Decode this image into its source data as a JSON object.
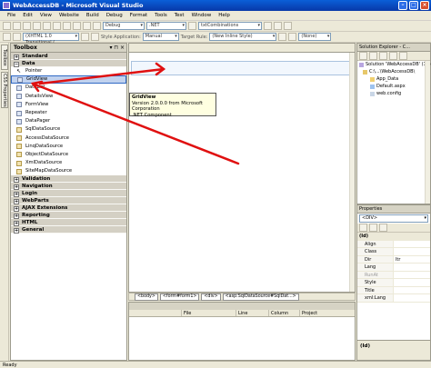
{
  "window": {
    "title": "WebAccessDB - Microsoft Visual Studio"
  },
  "menu": [
    "File",
    "Edit",
    "View",
    "Website",
    "Build",
    "Debug",
    "Format",
    "Tools",
    "Test",
    "Window",
    "Help"
  ],
  "toolbar1": {
    "config": "Debug",
    "platform": ".NET",
    "find": "txtCombinations"
  },
  "toolbar2": {
    "doctype": "(XHTML 1.0 Transitional (",
    "style_application_label": "Style Application:",
    "style_application": "Manual",
    "target_rule_label": "Target Rule:",
    "target_rule": "(New Inline Style)",
    "font": "(None)"
  },
  "left_tabs": [
    "Toolbox",
    "CSS Properties"
  ],
  "toolbox": {
    "title": "Toolbox",
    "categories_top": [
      "Standard",
      "Data"
    ],
    "data_items": [
      "Pointer",
      "GridView",
      "DataList",
      "DetailsView",
      "FormView",
      "Repeater",
      "DataPager",
      "SqlDataSource",
      "AccessDataSource",
      "LinqDataSource",
      "ObjectDataSource",
      "XmlDataSource",
      "SiteMapDataSource"
    ],
    "categories_bottom": [
      "Validation",
      "Navigation",
      "Login",
      "WebParts",
      "AJAX Extensions",
      "Reporting",
      "HTML",
      "General"
    ]
  },
  "tooltip": {
    "title": "GridView",
    "line1": "Version 2.0.0.0 from Microsoft Corporation",
    "line2": ".NET Component"
  },
  "tag_nav": [
    "<body>",
    "<form#form1>",
    "<div>",
    "<asp:SqlDataSource#SqlDat...>"
  ],
  "error_list": {
    "columns": [
      "File",
      "Line",
      "Column",
      "Project"
    ]
  },
  "solution_explorer": {
    "title": "Solution Explorer - C...",
    "nodes": [
      "Solution 'WebAccessDB' (1 project)",
      "C:\\...\\WebAccessDB\\",
      "App_Data",
      "Default.aspx",
      "web.config"
    ]
  },
  "properties": {
    "title": "Properties",
    "selected": "<DIV>",
    "group": "(Id)",
    "rows": [
      {
        "name": "Align",
        "value": ""
      },
      {
        "name": "Class",
        "value": ""
      },
      {
        "name": "Dir",
        "value": "ltr"
      },
      {
        "name": "Lang",
        "value": ""
      },
      {
        "name": "RunAt",
        "value": ""
      },
      {
        "name": "Style",
        "value": ""
      },
      {
        "name": "Title",
        "value": ""
      },
      {
        "name": "xml:Lang",
        "value": ""
      }
    ],
    "description": "(Id)"
  },
  "status": {
    "text": "Ready"
  },
  "colors": {
    "title_bar": "#0a5fd8",
    "selection": "#c1d2ee",
    "annotation_arrow": "#e01010"
  }
}
